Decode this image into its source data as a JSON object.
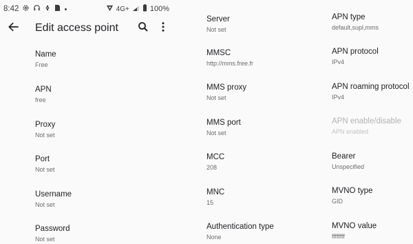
{
  "status_bar": {
    "time": "8:42",
    "network": "4G+",
    "battery": "100%"
  },
  "app_bar": {
    "title": "Edit access point",
    "icons": [
      "back-arrow-icon",
      "search-icon",
      "more-vert-icon"
    ]
  },
  "fields": {
    "name": {
      "title": "Name",
      "value": "Free"
    },
    "apn": {
      "title": "APN",
      "value": "free"
    },
    "proxy": {
      "title": "Proxy",
      "value": "Not set"
    },
    "port": {
      "title": "Port",
      "value": "Not set"
    },
    "username": {
      "title": "Username",
      "value": "Not set"
    },
    "password": {
      "title": "Password",
      "value": "Not set"
    },
    "server": {
      "title": "Server",
      "value": "Not set"
    },
    "mmsc": {
      "title": "MMSC",
      "value": "http://mms.free.fr"
    },
    "mms_proxy": {
      "title": "MMS proxy",
      "value": "Not set"
    },
    "mms_port": {
      "title": "MMS port",
      "value": "Not set"
    },
    "mcc": {
      "title": "MCC",
      "value": "208"
    },
    "mnc": {
      "title": "MNC",
      "value": "15"
    },
    "auth_type": {
      "title": "Authentication type",
      "value": "None"
    },
    "apn_type": {
      "title": "APN type",
      "value": "default,supl,mms"
    },
    "apn_protocol": {
      "title": "APN protocol",
      "value": "IPv4"
    },
    "apn_roaming_protocol": {
      "title": "APN roaming protocol",
      "value": "IPv4"
    },
    "apn_enable": {
      "title": "APN enable/disable",
      "value": "APN enabled"
    },
    "bearer": {
      "title": "Bearer",
      "value": "Unspecified"
    },
    "mvno_type": {
      "title": "MVNO type",
      "value": "GID"
    },
    "mvno_value": {
      "title": "MVNO value",
      "value": "ffffffff"
    }
  }
}
